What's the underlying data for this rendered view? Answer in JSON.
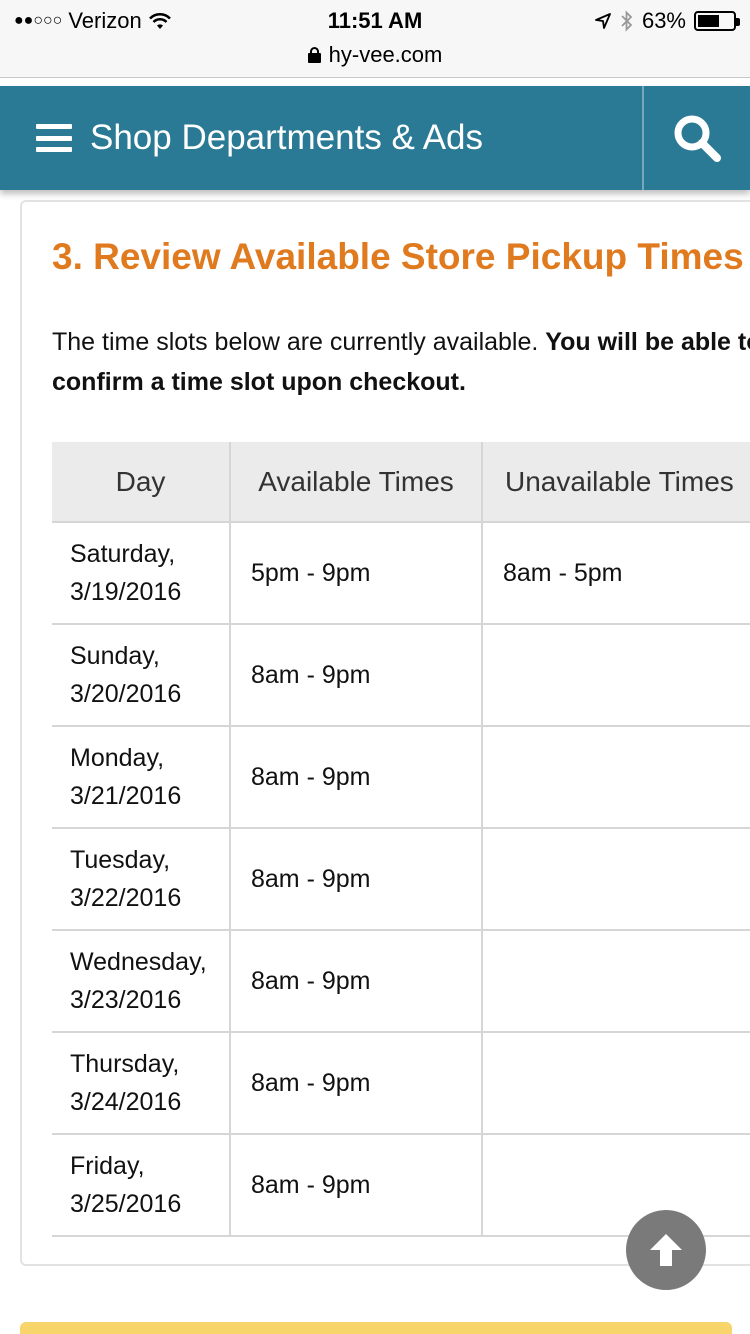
{
  "status_bar": {
    "signal": "●●○○○",
    "carrier": "Verizon",
    "wifi_icon": "wifi-icon",
    "time": "11:51 AM",
    "location_icon": "location-arrow-icon",
    "bluetooth_icon": "bluetooth-icon",
    "battery_percent": "63%",
    "battery_level": 0.63
  },
  "url_bar": {
    "domain": "hy-vee.com",
    "lock_icon": "lock-icon"
  },
  "header": {
    "menu_label": "Shop Departments & Ads",
    "menu_icon": "hamburger-icon",
    "search_icon": "search-icon",
    "background_color": "#2a7a95"
  },
  "section": {
    "title": "3. Review Available Store Pickup Times",
    "intro_plain": "The time slots below are currently available. ",
    "intro_bold": "You will be able to confirm a time slot upon checkout."
  },
  "table": {
    "headers": [
      "Day",
      "Available Times",
      "Unavailable Times"
    ],
    "rows": [
      {
        "day": "Saturday,",
        "date": "3/19/2016",
        "available": "5pm - 9pm",
        "unavailable": "8am - 5pm"
      },
      {
        "day": "Sunday,",
        "date": "3/20/2016",
        "available": "8am - 9pm",
        "unavailable": ""
      },
      {
        "day": "Monday,",
        "date": "3/21/2016",
        "available": "8am - 9pm",
        "unavailable": ""
      },
      {
        "day": "Tuesday,",
        "date": "3/22/2016",
        "available": "8am - 9pm",
        "unavailable": ""
      },
      {
        "day": "Wednesday,",
        "date": "3/23/2016",
        "available": "8am - 9pm",
        "unavailable": ""
      },
      {
        "day": "Thursday,",
        "date": "3/24/2016",
        "available": "8am - 9pm",
        "unavailable": ""
      },
      {
        "day": "Friday,",
        "date": "3/25/2016",
        "available": "8am - 9pm",
        "unavailable": ""
      }
    ]
  },
  "colors": {
    "title_orange": "#e07a1f",
    "unavailable_red": "#c0483b",
    "header_gray": "#ebebeb"
  },
  "scroll_top": {
    "icon": "arrow-up-icon"
  }
}
